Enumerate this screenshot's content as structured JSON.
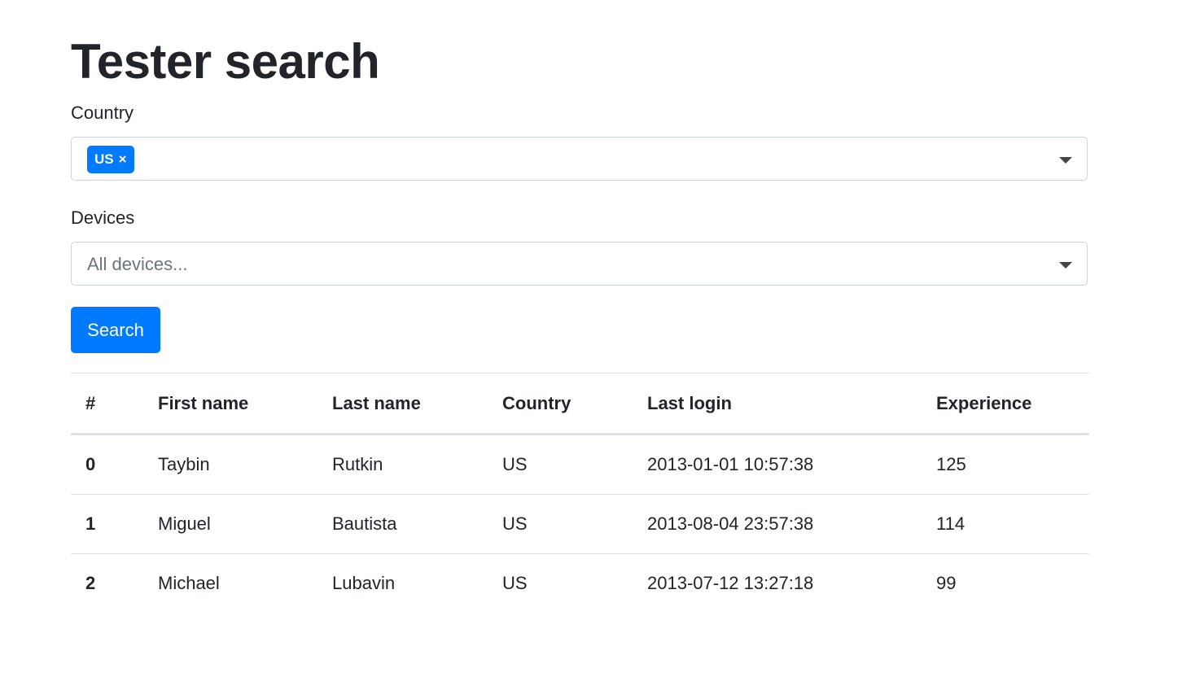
{
  "page": {
    "title": "Tester search"
  },
  "country_filter": {
    "label": "Country",
    "selected_tags": [
      "US"
    ],
    "remove_glyph": "×"
  },
  "devices_filter": {
    "label": "Devices",
    "placeholder": "All devices..."
  },
  "search_button": {
    "label": "Search"
  },
  "table": {
    "headers": [
      "#",
      "First name",
      "Last name",
      "Country",
      "Last login",
      "Experience"
    ],
    "rows": [
      {
        "index": "0",
        "first_name": "Taybin",
        "last_name": "Rutkin",
        "country": "US",
        "last_login": "2013-01-01 10:57:38",
        "experience": "125"
      },
      {
        "index": "1",
        "first_name": "Miguel",
        "last_name": "Bautista",
        "country": "US",
        "last_login": "2013-08-04 23:57:38",
        "experience": "114"
      },
      {
        "index": "2",
        "first_name": "Michael",
        "last_name": "Lubavin",
        "country": "US",
        "last_login": "2013-07-12 13:27:18",
        "experience": "99"
      }
    ]
  },
  "colors": {
    "accent": "#007bff",
    "text": "#212529",
    "border": "#ced4da",
    "table_border": "#dee2e6"
  },
  "icons": {
    "dropdown": "chevron-down-icon",
    "tag_remove": "close-icon"
  }
}
